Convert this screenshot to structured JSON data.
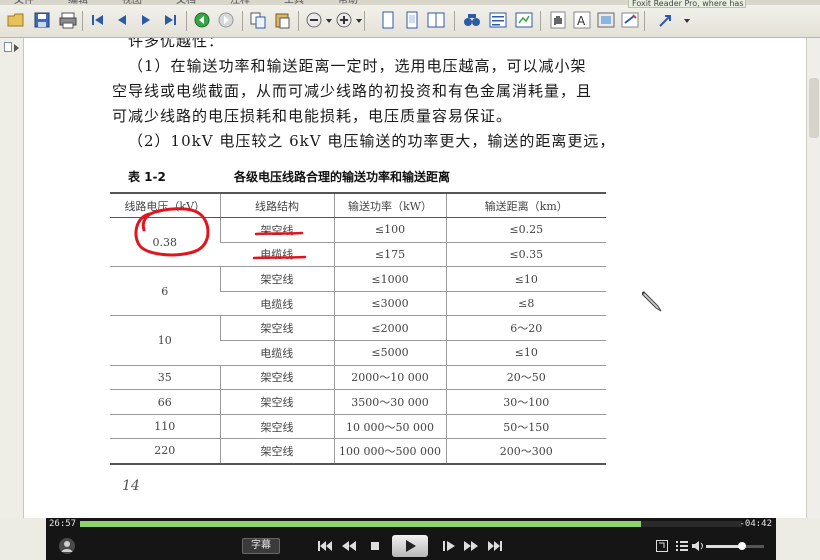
{
  "toolbar": {
    "menu_text": [
      "文件",
      "编辑",
      "视图",
      "文档",
      "注释",
      "工具",
      "帮助"
    ],
    "promo_text": "Foxit Reader Pro, where has a pro?",
    "icons": [
      "open-icon",
      "save-icon",
      "print-icon",
      "first-page-icon",
      "prev-page-icon",
      "next-page-icon",
      "last-page-icon",
      "go-back-icon",
      "go-forward-icon",
      "copy-icon",
      "paste-icon",
      "zoom-out-icon",
      "zoom-in-icon",
      "single-page-icon",
      "continuous-page-icon",
      "facing-page-icon",
      "find-icon",
      "text-view-icon",
      "annotation-icon",
      "hand-tool-icon",
      "select-text-icon",
      "snapshot-icon",
      "typewriter-icon"
    ]
  },
  "document": {
    "lines": [
      "许多优越性：",
      "（1）在输送功率和输送距离一定时，选用电压越高，可以减小架",
      "空导线或电缆截面，从而可减少线路的初投资和有色金属消耗量，且",
      "可减少线路的电压损耗和电能损耗，电压质量容易保证。",
      "（2）10kV 电压较之 6kV 电压输送的功率更大，输送的距离更远，"
    ],
    "table_caption": "表 1-2",
    "table_title": "各级电压线路合理的输送功率和输送距离",
    "headers": [
      "线路电压（kV）",
      "线路结构",
      "输送功率（kW）",
      "输送距离（km）"
    ],
    "groups": [
      {
        "voltage": "0.38",
        "rows": [
          [
            "架空线",
            "≤100",
            "≤0.25"
          ],
          [
            "电缆线",
            "≤175",
            "≤0.35"
          ]
        ]
      },
      {
        "voltage": "6",
        "rows": [
          [
            "架空线",
            "≤1000",
            "≤10"
          ],
          [
            "电缆线",
            "≤3000",
            "≤8"
          ]
        ]
      },
      {
        "voltage": "10",
        "rows": [
          [
            "架空线",
            "≤2000",
            "6～20"
          ],
          [
            "电缆线",
            "≤5000",
            "≤10"
          ]
        ]
      },
      {
        "voltage": "35",
        "rows": [
          [
            "架空线",
            "2000～10 000",
            "20～50"
          ]
        ]
      },
      {
        "voltage": "66",
        "rows": [
          [
            "架空线",
            "3500～30 000",
            "30～100"
          ]
        ]
      },
      {
        "voltage": "110",
        "rows": [
          [
            "架空线",
            "10 000～50 000",
            "50～150"
          ]
        ]
      },
      {
        "voltage": "220",
        "rows": [
          [
            "架空线",
            "100 000～500 000",
            "200～300"
          ]
        ]
      }
    ],
    "page_number": "14"
  },
  "player": {
    "current_time": "26:57",
    "remaining_time": "-04:42",
    "progress": 0.848,
    "subtitle_label": "字幕",
    "volume": 0.62
  },
  "colors": {
    "annotation_red": "#e0161e",
    "progress_green": "#8ed26c",
    "player_bg": "#151515"
  }
}
